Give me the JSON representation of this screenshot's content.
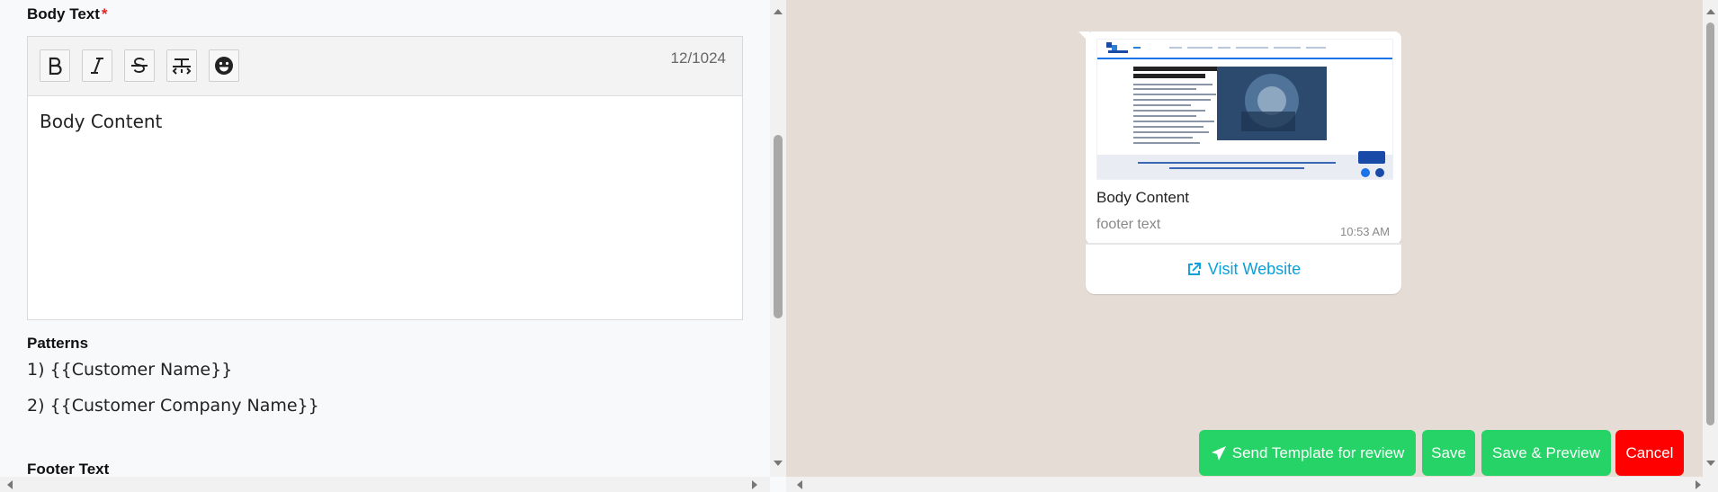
{
  "body_text_section": {
    "label": "Body Text",
    "required_mark": "*",
    "toolbar": {
      "bold_icon": "bold-icon",
      "italic_icon": "italic-icon",
      "strikethrough_icon": "strikethrough-icon",
      "monospace_icon": "monospace-icon",
      "emoji_icon": "emoji-icon"
    },
    "char_count": "12/1024",
    "content": "Body Content"
  },
  "patterns": {
    "label": "Patterns",
    "items": [
      "1) {{Customer Name}}",
      "2) {{Customer Company Name}}"
    ]
  },
  "footer_section": {
    "label": "Footer Text"
  },
  "preview": {
    "header_image": {
      "headline": "Transform Your Business with CBS Systems Corp.",
      "description": "Our suite of products and services is designed to enhance productivity, improve security and optimize business operations."
    },
    "body": "Body Content",
    "footer": "footer text",
    "time": "10:53 AM",
    "cta_label": "Visit Website",
    "cta_icon": "external-link-icon"
  },
  "actions": {
    "send_review": "Send Template for review",
    "send_icon": "paper-plane-icon",
    "save": "Save",
    "save_preview": "Save & Preview",
    "cancel": "Cancel"
  },
  "colors": {
    "whatsapp_green": "#25d366",
    "cancel_red": "#ff0000",
    "link_blue": "#0aa0db",
    "chat_background": "#e5ddd5",
    "required_red": "#e0262a"
  }
}
